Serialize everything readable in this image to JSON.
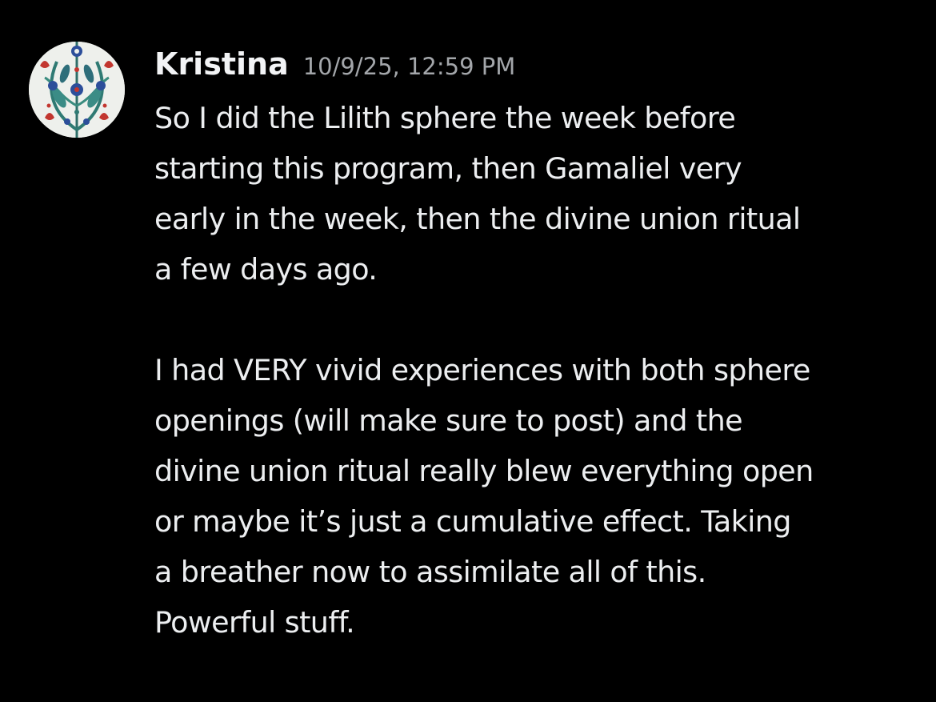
{
  "message": {
    "author": "Kristina",
    "timestamp": "10/9/25, 12:59 PM",
    "avatar_icon": "floral-tile-avatar-icon",
    "paragraphs": [
      [
        "So I did the Lilith sphere the week before",
        "starting this program, then Gamaliel very",
        "early in the week, then the divine union ritual",
        "a few days ago."
      ],
      [
        "I had VERY vivid experiences with both sphere",
        "openings (will make sure to post) and the",
        "divine union ritual really blew everything open",
        "or maybe it’s just a cumulative effect.  Taking",
        "a breather now to assimilate all of this.",
        "Powerful stuff."
      ]
    ]
  },
  "colors": {
    "background": "#000000",
    "author": "#f2f3f5",
    "timestamp": "#a3a6aa",
    "text": "#eceef0"
  }
}
